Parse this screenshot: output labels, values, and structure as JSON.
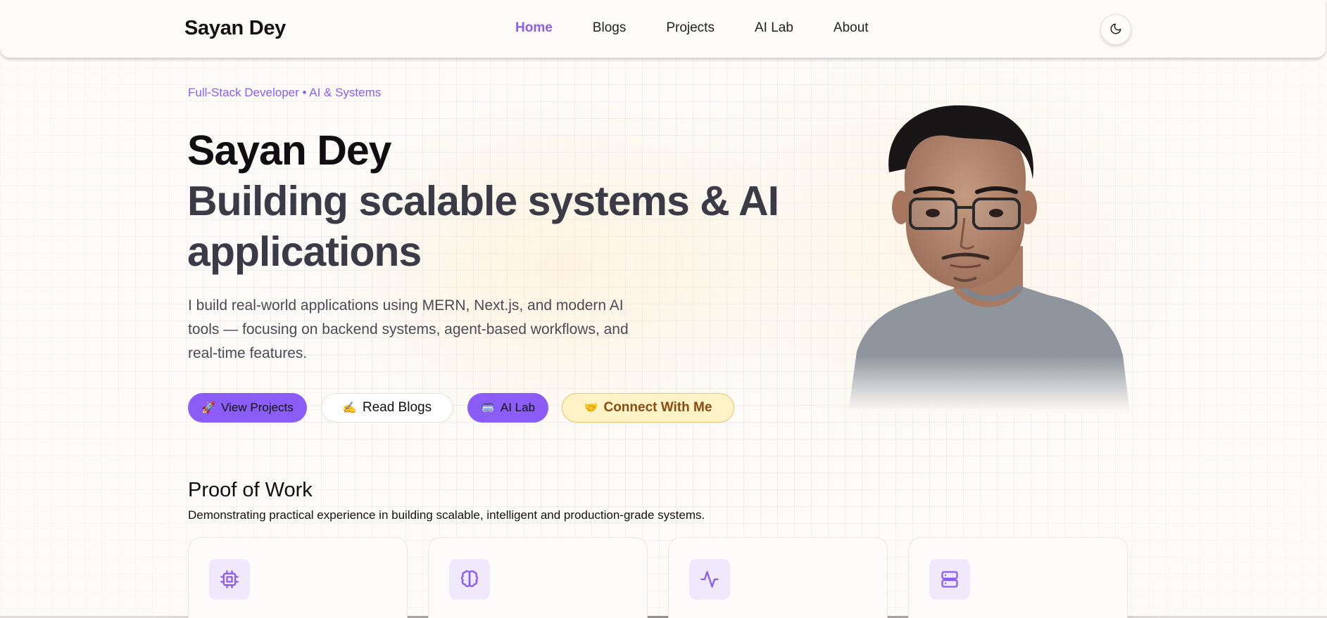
{
  "nav": {
    "brand": "Sayan Dey",
    "links": [
      "Home",
      "Blogs",
      "Projects",
      "AI Lab",
      "About"
    ],
    "active": "Home",
    "theme_toggle_icon": "moon-icon"
  },
  "hero": {
    "eyebrow": "Full-Stack Developer • AI & Systems",
    "title": "Sayan Dey",
    "subtitle": "Building scalable systems & AI applications",
    "description": "I build real-world applications using MERN, Next.js, and modern AI tools — focusing on backend systems, agent-based workflows, and real-time features.",
    "buttons": [
      {
        "emoji": "🚀",
        "label": "View Projects"
      },
      {
        "emoji": "✍️",
        "label": "Read Blogs"
      },
      {
        "emoji": "🥽",
        "label": "AI Lab"
      },
      {
        "emoji": "🤝",
        "label": "Connect With Me"
      }
    ]
  },
  "proof": {
    "title": "Proof of Work",
    "description": "Demonstrating practical experience in building scalable, intelligent and production-grade systems.",
    "card_icons": [
      "cpu-icon",
      "brain-icon",
      "activity-icon",
      "server-icon"
    ]
  },
  "colors": {
    "accent": "#8b5cf6",
    "amber_bg": "#fef3c7",
    "amber_text": "#8a4a10"
  }
}
